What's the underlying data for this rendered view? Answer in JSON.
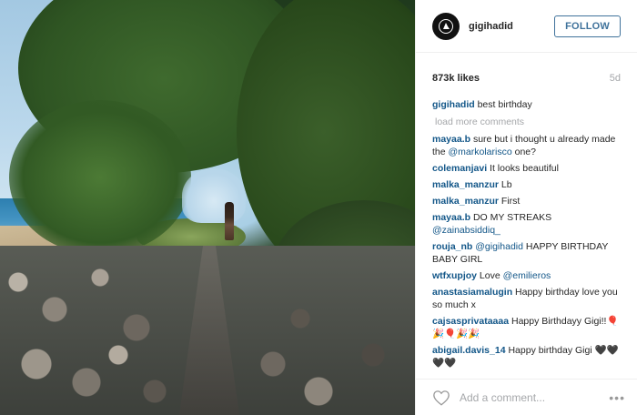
{
  "post": {
    "username": "gigihadid",
    "follow_label": "FOLLOW",
    "likes": "873k likes",
    "age": "5d",
    "caption": {
      "user": "gigihadid",
      "text": "best birthday"
    },
    "load_more": "load more comments"
  },
  "comments": [
    {
      "user": "mayaa.b",
      "pre": "sure but i thought u already made the ",
      "mention": "@markolarisco",
      "post": " one?"
    },
    {
      "user": "colemanjavi",
      "pre": "It looks beautiful",
      "mention": "",
      "post": ""
    },
    {
      "user": "malka_manzur",
      "pre": "Lb",
      "mention": "",
      "post": ""
    },
    {
      "user": "malka_manzur",
      "pre": "First",
      "mention": "",
      "post": ""
    },
    {
      "user": "mayaa.b",
      "pre": "DO MY STREAKS ",
      "mention": "@zainabsiddiq_",
      "post": ""
    },
    {
      "user": "rouja_nb",
      "pre": "",
      "mention": "@gigihadid",
      "post": " HAPPY BIRTHDAY BABY GIRL"
    },
    {
      "user": "wtfxupjoy",
      "pre": "Love ",
      "mention": "@emilieros",
      "post": ""
    },
    {
      "user": "anastasiamalugin",
      "pre": "Happy birthday love you so much x",
      "mention": "",
      "post": ""
    },
    {
      "user": "cajsasprivataaaa",
      "pre": "Happy Birthdayy Gigi!!🎈🎉🎈🎉🎉",
      "mention": "",
      "post": ""
    },
    {
      "user": "abigail.davis_14",
      "pre": "Happy birthday Gigi 🖤🖤🖤🖤",
      "mention": "",
      "post": ""
    }
  ],
  "add_comment": {
    "placeholder": "Add a comment..."
  },
  "icons": {
    "heart": "heart-outline-icon",
    "more": "more-dots-icon",
    "avatar": "avatar-logo"
  },
  "colors": {
    "link": "#125688",
    "follow": "#3f729b",
    "muted": "#a5a7aa"
  }
}
